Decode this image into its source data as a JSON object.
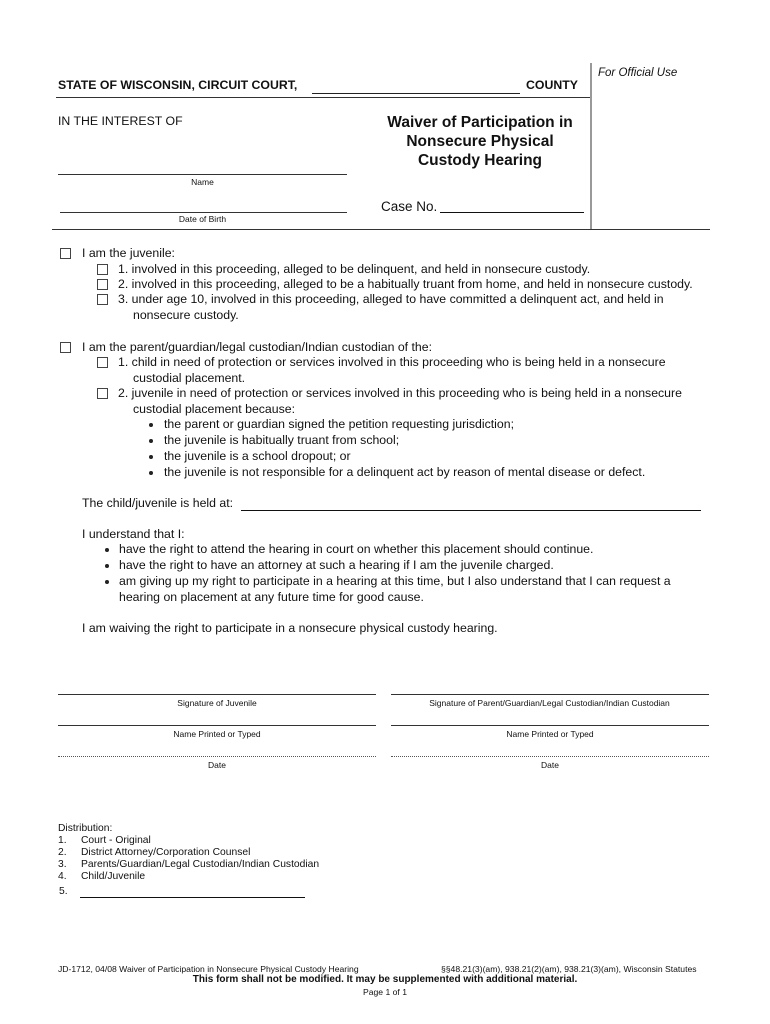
{
  "header": {
    "court_prefix": "STATE OF WISCONSIN, CIRCUIT COURT,",
    "county_suffix": "COUNTY",
    "official_use": "For Official Use",
    "in_the_interest_of": "IN THE INTEREST OF",
    "name_label": "Name",
    "dob_label": "Date of Birth",
    "title_lines": [
      "Waiver of Participation in",
      "Nonsecure Physical",
      "Custody Hearing"
    ],
    "case_no_label": "Case No."
  },
  "juvenile_section": {
    "label": "I am the juvenile:",
    "checked": false,
    "options": [
      {
        "text": "1. involved in this proceeding, alleged to be delinquent, and held in nonsecure custody.",
        "checked": false
      },
      {
        "text": "2. involved in this proceeding, alleged to be a habitually truant from home, and held in nonsecure custody.",
        "checked": false
      },
      {
        "text_lines": [
          "3. under age 10, involved in this proceeding, alleged to have committed a delinquent act, and held in",
          "nonsecure custody."
        ],
        "checked": false
      }
    ]
  },
  "parent_section": {
    "label": "I am the parent/guardian/legal custodian/Indian custodian of the:",
    "checked": false,
    "options": [
      {
        "text_lines": [
          "1. child in need of protection or services involved in this proceeding who is being held in a nonsecure",
          "custodial placement."
        ],
        "checked": false
      },
      {
        "text_lines": [
          "2. juvenile in need of protection or services involved in this proceeding who is being held in a nonsecure",
          "custodial placement because:"
        ],
        "checked": false,
        "bullets": [
          "the parent or guardian signed the petition requesting jurisdiction;",
          "the juvenile is habitually truant from school;",
          "the juvenile is a school dropout; or",
          "the juvenile is not responsible for a delinquent act by reason of mental disease or defect."
        ]
      }
    ]
  },
  "held_at": {
    "label": "The child/juvenile is held at:",
    "value": ""
  },
  "understand": {
    "label": "I understand that I:",
    "bullets": [
      [
        "have the right to attend the hearing in court on whether this placement should continue."
      ],
      [
        "have the right to have an attorney at such a hearing if I am the juvenile charged."
      ],
      [
        "am giving up my right to participate in a hearing at this time, but I also understand that I can request a",
        "hearing on placement at any future time for good cause."
      ]
    ]
  },
  "waiver_statement": "I am waiving the right to participate in a nonsecure physical custody hearing.",
  "signatures": {
    "left": [
      "Signature of Juvenile",
      "Name Printed or Typed",
      "Date"
    ],
    "right": [
      "Signature of Parent/Guardian/Legal Custodian/Indian Custodian",
      "Name Printed or Typed",
      "Date"
    ]
  },
  "distribution": {
    "label": "Distribution:",
    "items": [
      {
        "num": "1.",
        "text": "Court - Original"
      },
      {
        "num": "2.",
        "text": "District Attorney/Corporation Counsel"
      },
      {
        "num": "3.",
        "text": "Parents/Guardian/Legal Custodian/Indian Custodian"
      },
      {
        "num": "4.",
        "text": "Child/Juvenile"
      },
      {
        "num": "5.",
        "text": ""
      }
    ]
  },
  "footer": {
    "form_id": "JD-1712, 04/08 Waiver of Participation in Nonsecure Physical Custody Hearing",
    "statutes": "§§48.21(3)(am), 938.21(2)(am), 938.21(3)(am), Wisconsin Statutes",
    "notice": "This form shall not be modified. It may be supplemented with additional material.",
    "page": "Page 1 of 1"
  }
}
